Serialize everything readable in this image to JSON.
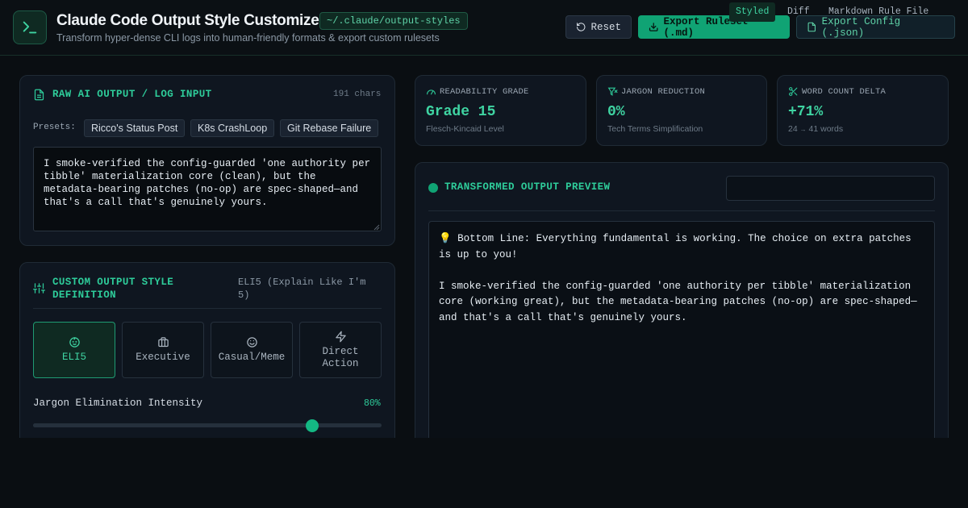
{
  "header": {
    "title": "Claude Code Output Style Customizer",
    "path_badge": "~/.claude/output-styles",
    "subtitle": "Transform hyper-dense CLI logs into human-friendly formats & export custom rulesets",
    "reset_label": "Reset",
    "export_md_label": "Export Ruleset (.md)",
    "export_json_label": "Export Config (.json)"
  },
  "raw_input": {
    "title": "RAW AI OUTPUT / LOG INPUT",
    "char_count": "191 chars",
    "presets_label": "Presets:",
    "presets": [
      "Ricco's Status Post",
      "K8s CrashLoop",
      "Git Rebase Failure"
    ],
    "text": "I smoke-verified the config-guarded 'one authority per tibble' materialization core (clean), but the metadata-bearing patches (no-op) are spec-shaped—and that's a call that's genuinely yours."
  },
  "style_definition": {
    "title": "CUSTOM OUTPUT STYLE DEFINITION",
    "selected_style_name": "ELI5 (Explain Like I'm 5)",
    "styles": [
      {
        "label": "ELI5",
        "icon": "baby-face-icon",
        "active": true
      },
      {
        "label": "Executive",
        "icon": "briefcase-icon",
        "active": false
      },
      {
        "label": "Casual/Meme",
        "icon": "smile-icon",
        "active": false
      },
      {
        "label": "Direct Action",
        "icon": "lightning-icon",
        "active": false
      }
    ],
    "slider_label": "Jargon Elimination Intensity",
    "slider_value_text": "80%",
    "slider_value": 0.8
  },
  "metrics": [
    {
      "label": "READABILITY GRADE",
      "icon": "gauge-icon",
      "value": "Grade 15",
      "sub": "Flesch-Kincaid Level"
    },
    {
      "label": "JARGON REDUCTION",
      "icon": "filter-icon",
      "value": "0%",
      "sub": "Tech Terms Simplification"
    },
    {
      "label": "WORD COUNT DELTA",
      "icon": "scissors-icon",
      "value": "+71%",
      "sub_from": "24",
      "sub_arrow": "→",
      "sub_to": "41 words"
    }
  ],
  "preview": {
    "title": "TRANSFORMED OUTPUT PREVIEW",
    "tabs": [
      "Styled",
      "Diff",
      "Markdown Rule File"
    ],
    "bottom_line": "💡 Bottom Line: Everything fundamental is working. The choice on extra patches is up to you!",
    "body": "I smoke-verified the config-guarded 'one authority per tibble' materialization core (working great), but the metadata-bearing patches (no-op) are spec-shaped—and that's a call that's genuinely yours."
  },
  "colors": {
    "accent": "#2ecc9a",
    "background": "#0a0e12",
    "panel": "#0f1620"
  }
}
